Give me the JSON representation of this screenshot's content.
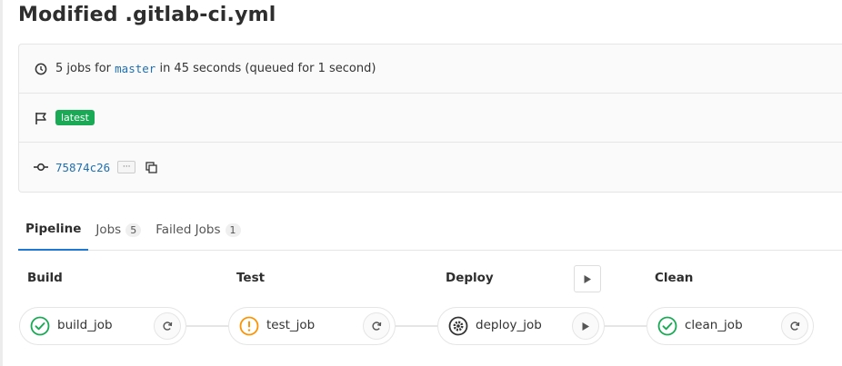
{
  "page": {
    "title": "Modified .gitlab-ci.yml"
  },
  "info": {
    "summary_prefix": "5 jobs for",
    "branch": "master",
    "summary_suffix": "in 45 seconds (queued for 1 second)",
    "badge": "latest",
    "commit_sha": "75874c26",
    "ellipsis": "···"
  },
  "tabs": [
    {
      "label": "Pipeline",
      "count": null
    },
    {
      "label": "Jobs",
      "count": "5"
    },
    {
      "label": "Failed Jobs",
      "count": "1"
    }
  ],
  "stages": [
    {
      "title": "Build"
    },
    {
      "title": "Test"
    },
    {
      "title": "Deploy"
    },
    {
      "title": "Clean"
    }
  ],
  "jobs": [
    {
      "name": "build_job",
      "status": "success",
      "status_icon": "check-circle-icon",
      "action_icon": "retry-icon"
    },
    {
      "name": "test_job",
      "status": "warning",
      "status_icon": "warning-circle-icon",
      "action_icon": "retry-icon"
    },
    {
      "name": "deploy_job",
      "status": "manual",
      "status_icon": "gear-icon",
      "action_icon": "play-icon"
    },
    {
      "name": "clean_job",
      "status": "success",
      "status_icon": "check-circle-icon",
      "action_icon": "retry-icon"
    }
  ],
  "colors": {
    "success": "#1aaa55",
    "warning": "#fc9403",
    "manual": "#333333",
    "link": "#1f6fb2",
    "tab_active": "#1f78d1"
  }
}
